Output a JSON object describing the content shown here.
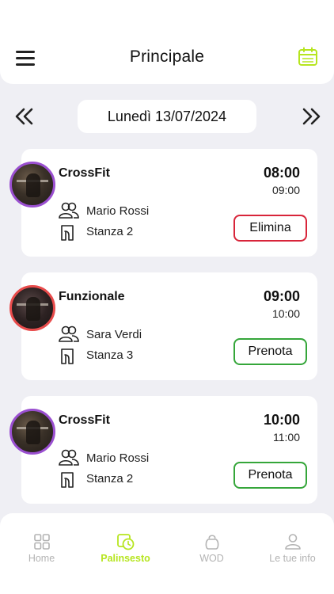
{
  "header": {
    "title": "Principale"
  },
  "date_nav": {
    "date_label": "Lunedì 13/07/2024"
  },
  "classes": [
    {
      "name": "CrossFit",
      "start": "08:00",
      "end": "09:00",
      "trainer": "Mario Rossi",
      "room": "Stanza 2",
      "action": "Elimina",
      "action_type": "delete",
      "avatar_ring": "#9a4fd0"
    },
    {
      "name": "Funzionale",
      "start": "09:00",
      "end": "10:00",
      "trainer": "Sara Verdi",
      "room": "Stanza 3",
      "action": "Prenota",
      "action_type": "book",
      "avatar_ring": "#e84b4b"
    },
    {
      "name": "CrossFit",
      "start": "10:00",
      "end": "11:00",
      "trainer": "Mario Rossi",
      "room": "Stanza 2",
      "action": "Prenota",
      "action_type": "book",
      "avatar_ring": "#9a4fd0"
    }
  ],
  "bottom_nav": {
    "items": [
      {
        "label": "Home",
        "icon": "grid-icon"
      },
      {
        "label": "Palinsesto",
        "icon": "schedule-icon",
        "active": true
      },
      {
        "label": "WOD",
        "icon": "kettlebell-icon"
      },
      {
        "label": "Le tue info",
        "icon": "user-icon"
      }
    ]
  },
  "colors": {
    "accent": "#b6e51f",
    "delete": "#d8253a",
    "book": "#35a63a"
  }
}
